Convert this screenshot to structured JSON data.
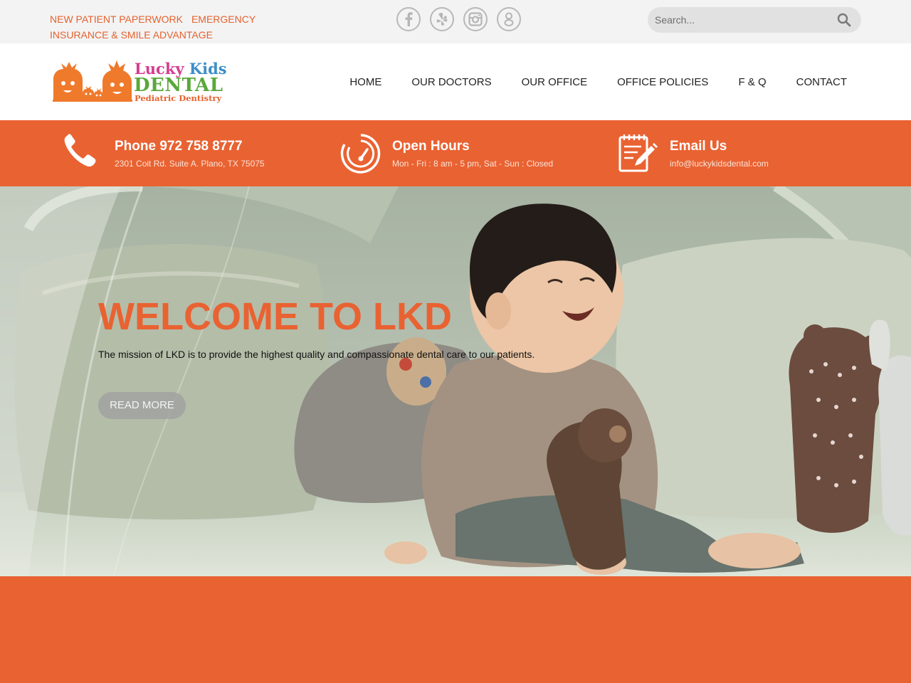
{
  "topbar": {
    "links": [
      "NEW PATIENT PAPERWORK",
      "EMERGENCY",
      "INSURANCE & SMILE ADVANTAGE"
    ],
    "social_icons": [
      "facebook-icon",
      "yelp-icon",
      "instagram-icon",
      "google-icon"
    ],
    "search": {
      "placeholder": "Search...",
      "icon": "search-icon"
    }
  },
  "logo": {
    "line1_a": "Lucky",
    "line1_b": "Kids",
    "line2": "DENTAL",
    "line3": "Pediatric Dentistry"
  },
  "nav": {
    "items": [
      "HOME",
      "OUR DOCTORS",
      "OUR OFFICE",
      "OFFICE POLICIES",
      "F & Q",
      "CONTACT"
    ]
  },
  "info": {
    "phone": {
      "title": "Phone 972 758 8777",
      "sub": "2301 Coit Rd. Suite A. Plano, TX 75075",
      "icon": "phone-icon"
    },
    "hours": {
      "title": "Open Hours",
      "sub": "Mon - Fri : 8 am - 5 pm, Sat - Sun : Closed",
      "icon": "gauge-icon"
    },
    "email": {
      "title": "Email Us",
      "sub": "info@luckykidsdental.com",
      "icon": "notepad-pencil-icon"
    }
  },
  "hero": {
    "heading": "WELCOME TO LKD",
    "text": "The mission of LKD is to provide the highest quality and compassionate dental care to our patients.",
    "button": "READ MORE"
  },
  "colors": {
    "brand_orange": "#e96232",
    "topbar_bg": "#f3f3f3",
    "logo_pink": "#d63c8f",
    "logo_blue": "#3c8ec8",
    "logo_green": "#5aa83b"
  }
}
